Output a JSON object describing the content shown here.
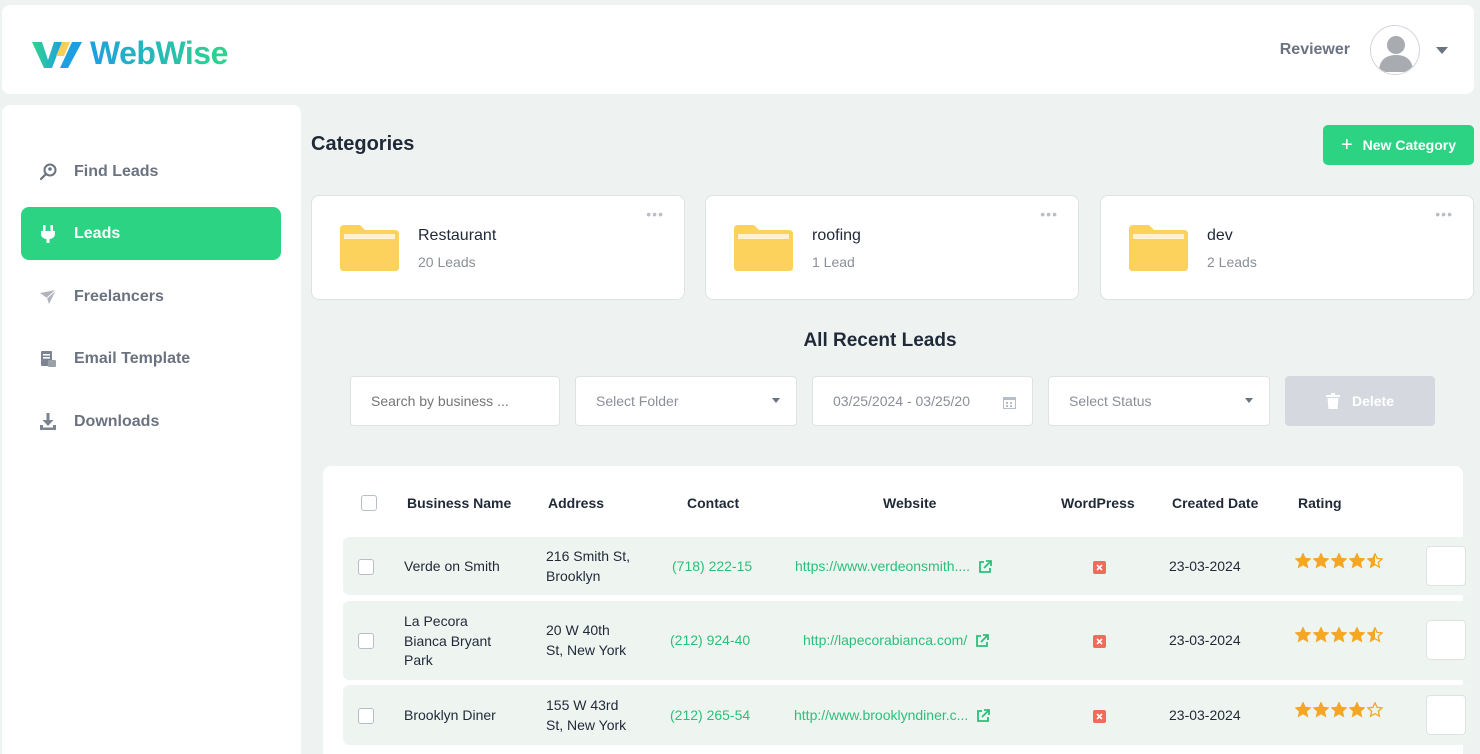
{
  "app": {
    "logo_text": "WebWise",
    "brand_colors": [
      "#1ea0e0",
      "#2ed68a"
    ]
  },
  "header": {
    "user_name": "Reviewer"
  },
  "sidebar": {
    "items": [
      {
        "label": "Find Leads",
        "icon": "search-person-icon",
        "active": false
      },
      {
        "label": "Leads",
        "icon": "plug-icon",
        "active": true
      },
      {
        "label": "Freelancers",
        "icon": "paper-plane-icon",
        "active": false
      },
      {
        "label": "Email Template",
        "icon": "document-icon",
        "active": false
      },
      {
        "label": "Downloads",
        "icon": "download-icon",
        "active": false
      }
    ]
  },
  "categories": {
    "title": "Categories",
    "new_button": "New Category",
    "items": [
      {
        "name": "Restaurant",
        "count": "20 Leads"
      },
      {
        "name": "roofing",
        "count": "1 Lead"
      },
      {
        "name": "dev",
        "count": "2 Leads"
      }
    ]
  },
  "recent": {
    "title": "All Recent Leads",
    "search_placeholder": "Search by business ...",
    "folder_select": "Select Folder",
    "date_range": "03/25/2024 - 03/25/20",
    "status_select": "Select Status",
    "delete_label": "Delete"
  },
  "table": {
    "headers": [
      "Business Name",
      "Address",
      "Contact",
      "Website",
      "WordPress",
      "Created Date",
      "Rating"
    ],
    "rows": [
      {
        "name": [
          "Verde on Smith"
        ],
        "address": [
          "216 Smith St,",
          "Brooklyn"
        ],
        "contact": "(718) 222-15",
        "website": "https://www.verdeonsmith....",
        "wordpress": false,
        "date": "23-03-2024",
        "rating": 4.5
      },
      {
        "name": [
          "La Pecora",
          "Bianca Bryant",
          "Park"
        ],
        "address": [
          "20 W 40th",
          "St, New York"
        ],
        "contact": "(212) 924-40",
        "website": "http://lapecorabianca.com/",
        "wordpress": false,
        "date": "23-03-2024",
        "rating": 4.5
      },
      {
        "name": [
          "Brooklyn Diner"
        ],
        "address": [
          "155 W 43rd",
          "St, New York"
        ],
        "contact": "(212) 265-54",
        "website": "http://www.brooklyndiner.c...",
        "wordpress": false,
        "date": "23-03-2024",
        "rating": 4
      }
    ]
  },
  "colors": {
    "accent": "#2bd382",
    "star": "#f5a623",
    "wordpress_no": "#f26a5b"
  }
}
